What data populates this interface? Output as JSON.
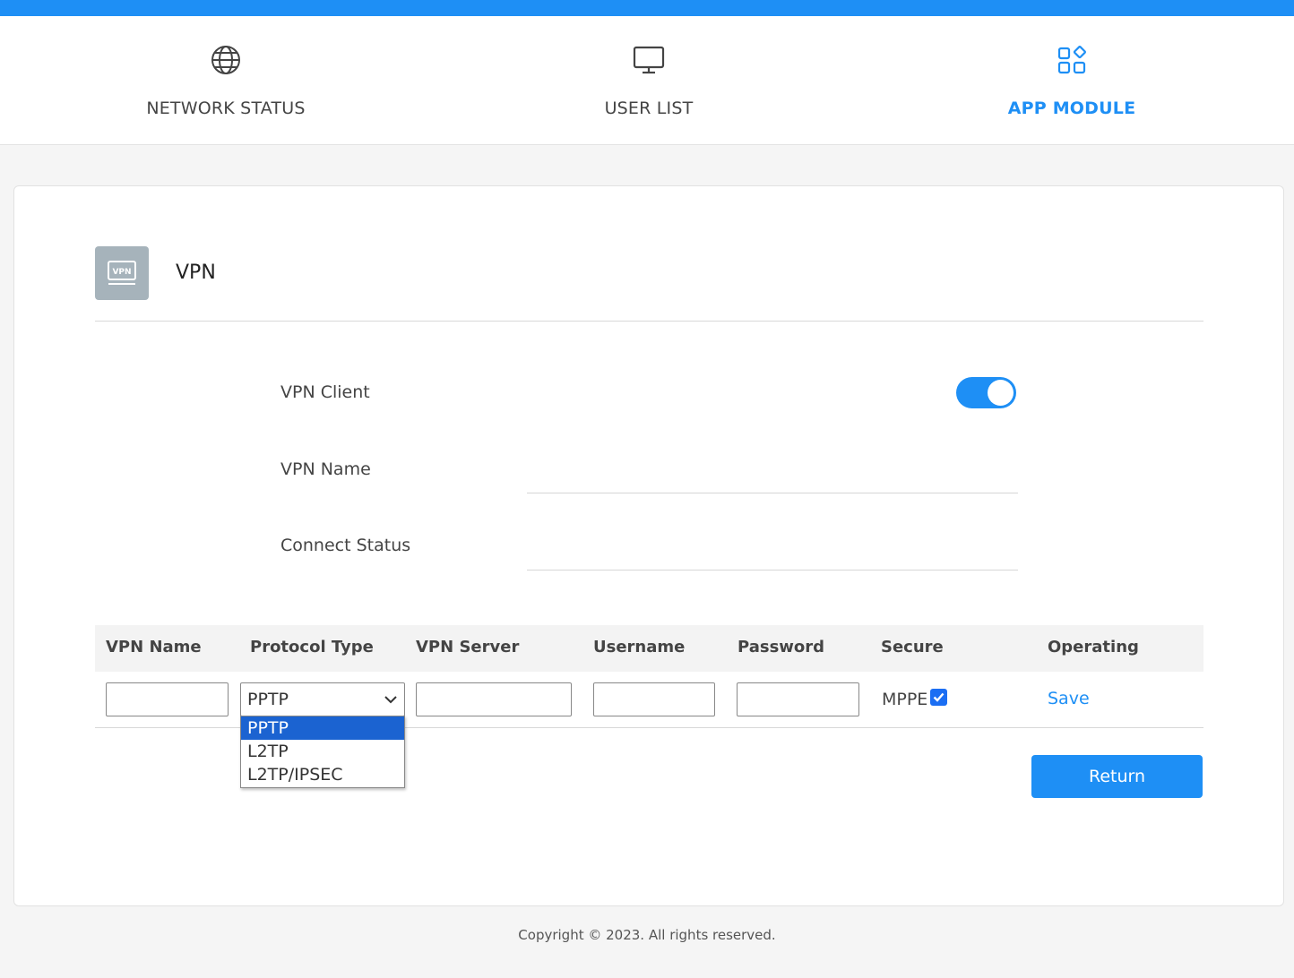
{
  "colors": {
    "accent": "#1e8ff5",
    "selected_option": "#1b63d1"
  },
  "nav": {
    "items": [
      {
        "label": "NETWORK STATUS",
        "icon": "globe-icon",
        "active": false
      },
      {
        "label": "USER LIST",
        "icon": "monitor-icon",
        "active": false
      },
      {
        "label": "APP MODULE",
        "icon": "apps-icon",
        "active": true
      }
    ]
  },
  "section": {
    "title": "VPN",
    "icon_text": "VPN"
  },
  "form": {
    "vpn_client_label": "VPN Client",
    "vpn_client_enabled": true,
    "vpn_name_label": "VPN Name",
    "vpn_name_value": "",
    "connect_status_label": "Connect Status",
    "connect_status_value": ""
  },
  "table": {
    "headers": [
      "VPN Name",
      "Protocol Type",
      "VPN Server",
      "Username",
      "Password",
      "Secure",
      "Operating"
    ],
    "row": {
      "vpn_name": "",
      "protocol": "PPTP",
      "vpn_server": "",
      "username": "",
      "password": "",
      "secure_label": "MPPE",
      "secure_checked": true,
      "operating_label": "Save"
    },
    "protocol_options": [
      "PPTP",
      "L2TP",
      "L2TP/IPSEC"
    ],
    "protocol_selected_index": 0
  },
  "actions": {
    "return_label": "Return"
  },
  "footer": {
    "copyright": "Copyright © 2023. All rights reserved."
  }
}
